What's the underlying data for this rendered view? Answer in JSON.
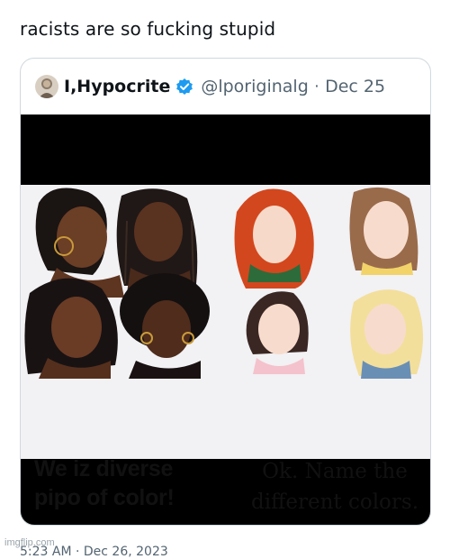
{
  "post": {
    "text": "racists are so fucking stupid"
  },
  "quoted_tweet": {
    "display_name": "I,Hypocrite",
    "handle": "@lporiginalg",
    "separator": "·",
    "date": "Dec 25",
    "verified_color": "#1d9bf0",
    "meme": {
      "left_caption": [
        "We iz diverse",
        "pipo of color!"
      ],
      "right_caption": [
        "Ok. Name the",
        "different colors."
      ]
    }
  },
  "footer": {
    "watermark": "imgflip.com",
    "timestamp_partial": "5:23 AM · Dec 26, 2023"
  },
  "colors": {
    "accent": "#1d9bf0",
    "text": "#0f1419",
    "muted": "#536471",
    "border": "#cfd9de"
  },
  "icons": [
    "verified-badge-icon",
    "avatar-image"
  ]
}
